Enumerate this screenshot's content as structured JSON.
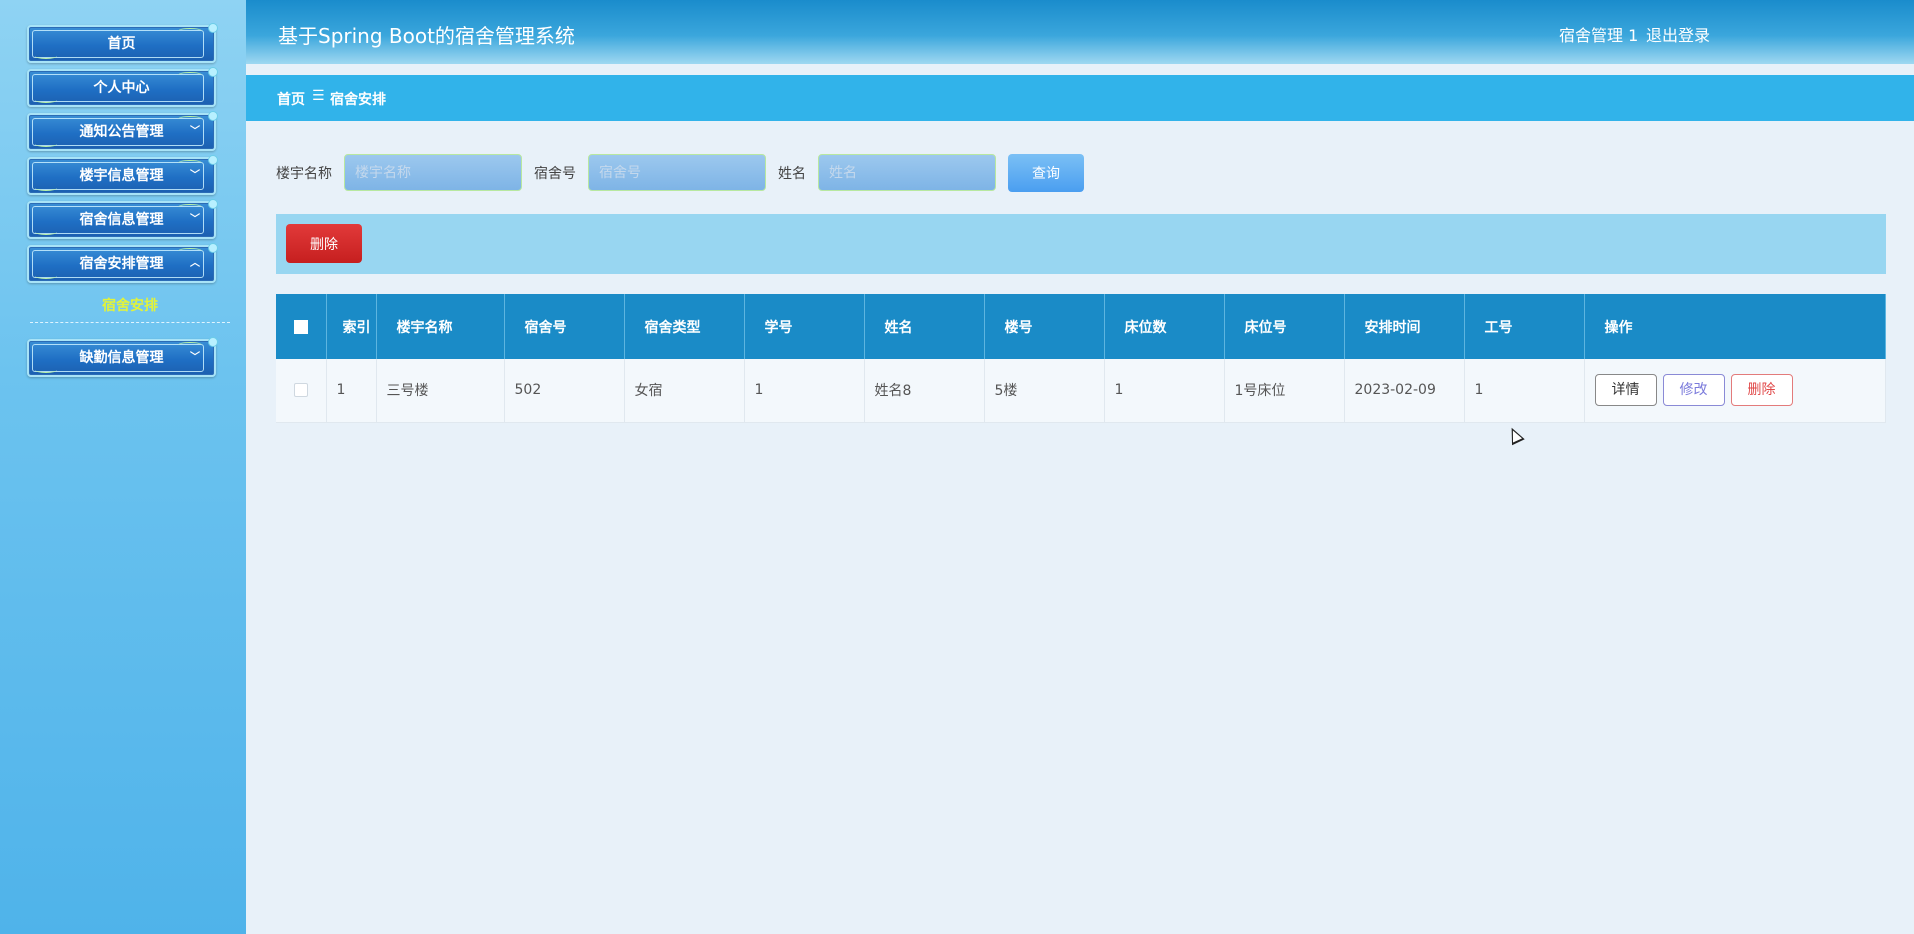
{
  "header": {
    "title": "基于Spring Boot的宿舍管理系统",
    "user": "宿舍管理 1",
    "logout": "退出登录"
  },
  "sidebar": {
    "items": [
      {
        "label": "首页"
      },
      {
        "label": "个人中心"
      },
      {
        "label": "通知公告管理"
      },
      {
        "label": "楼宇信息管理"
      },
      {
        "label": "宿舍信息管理"
      },
      {
        "label": "宿舍安排管理"
      },
      {
        "label": "缺勤信息管理"
      }
    ],
    "active_sub": "宿舍安排"
  },
  "breadcrumb": {
    "home": "首页",
    "separator": "☰",
    "current": "宿舍安排"
  },
  "search": {
    "building_label": "楼宇名称",
    "building_placeholder": "楼宇名称",
    "dorm_label": "宿舍号",
    "dorm_placeholder": "宿舍号",
    "name_label": "姓名",
    "name_placeholder": "姓名",
    "query_label": "查询"
  },
  "actions": {
    "delete_label": "删除"
  },
  "table": {
    "headers": [
      "索引",
      "楼宇名称",
      "宿舍号",
      "宿舍类型",
      "学号",
      "姓名",
      "楼号",
      "床位数",
      "床位号",
      "安排时间",
      "工号",
      "操作"
    ],
    "rows": [
      [
        "1",
        "三号楼",
        "502",
        "女宿",
        "1",
        "姓名8",
        "5楼",
        "1",
        "1号床位",
        "2023-02-09",
        "1"
      ]
    ],
    "ops": {
      "detail": "详情",
      "edit": "修改",
      "delete": "删除"
    }
  },
  "colors": {
    "header_bg": "#1a8ccc",
    "breadcrumb_bg": "#31b3ea",
    "table_header_bg": "#1a8bc7",
    "delete_btn": "#d62828",
    "active_sub": "#e2f33a"
  }
}
